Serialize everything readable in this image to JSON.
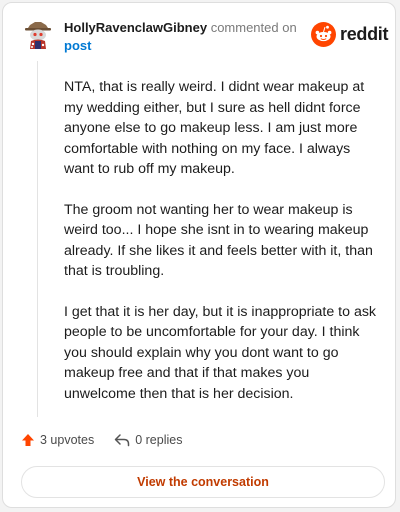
{
  "header": {
    "username": "HollyRavenclawGibney",
    "action_text": "commented on",
    "post_link": "post"
  },
  "logo": {
    "text": "reddit",
    "icon": "reddit-snoo-icon",
    "color": "#ff4500"
  },
  "comment": {
    "paragraphs": [
      "NTA, that is really weird. I didnt wear makeup at my wedding either, but I sure as hell didnt force anyone else to go makeup less. I am just more comfortable with nothing on my face. I always want to rub off my makeup.",
      "The groom not wanting her to wear makeup is weird too... I hope she isnt in to wearing makeup already. If she likes it and feels better with it, than that is troubling.",
      "I get that it is her day, but it is inappropriate to ask people to be uncomfortable for your day. I think you should explain why you dont want to go makeup free and that if that makes you unwelcome then that is her decision."
    ]
  },
  "actions": {
    "upvotes": "3 upvotes",
    "replies": "0 replies",
    "upvote_icon": "upvote-arrow-icon",
    "reply_icon": "reply-icon",
    "upvote_color": "#ff4500"
  },
  "cta": {
    "label": "View the conversation",
    "color": "#c13b00"
  }
}
